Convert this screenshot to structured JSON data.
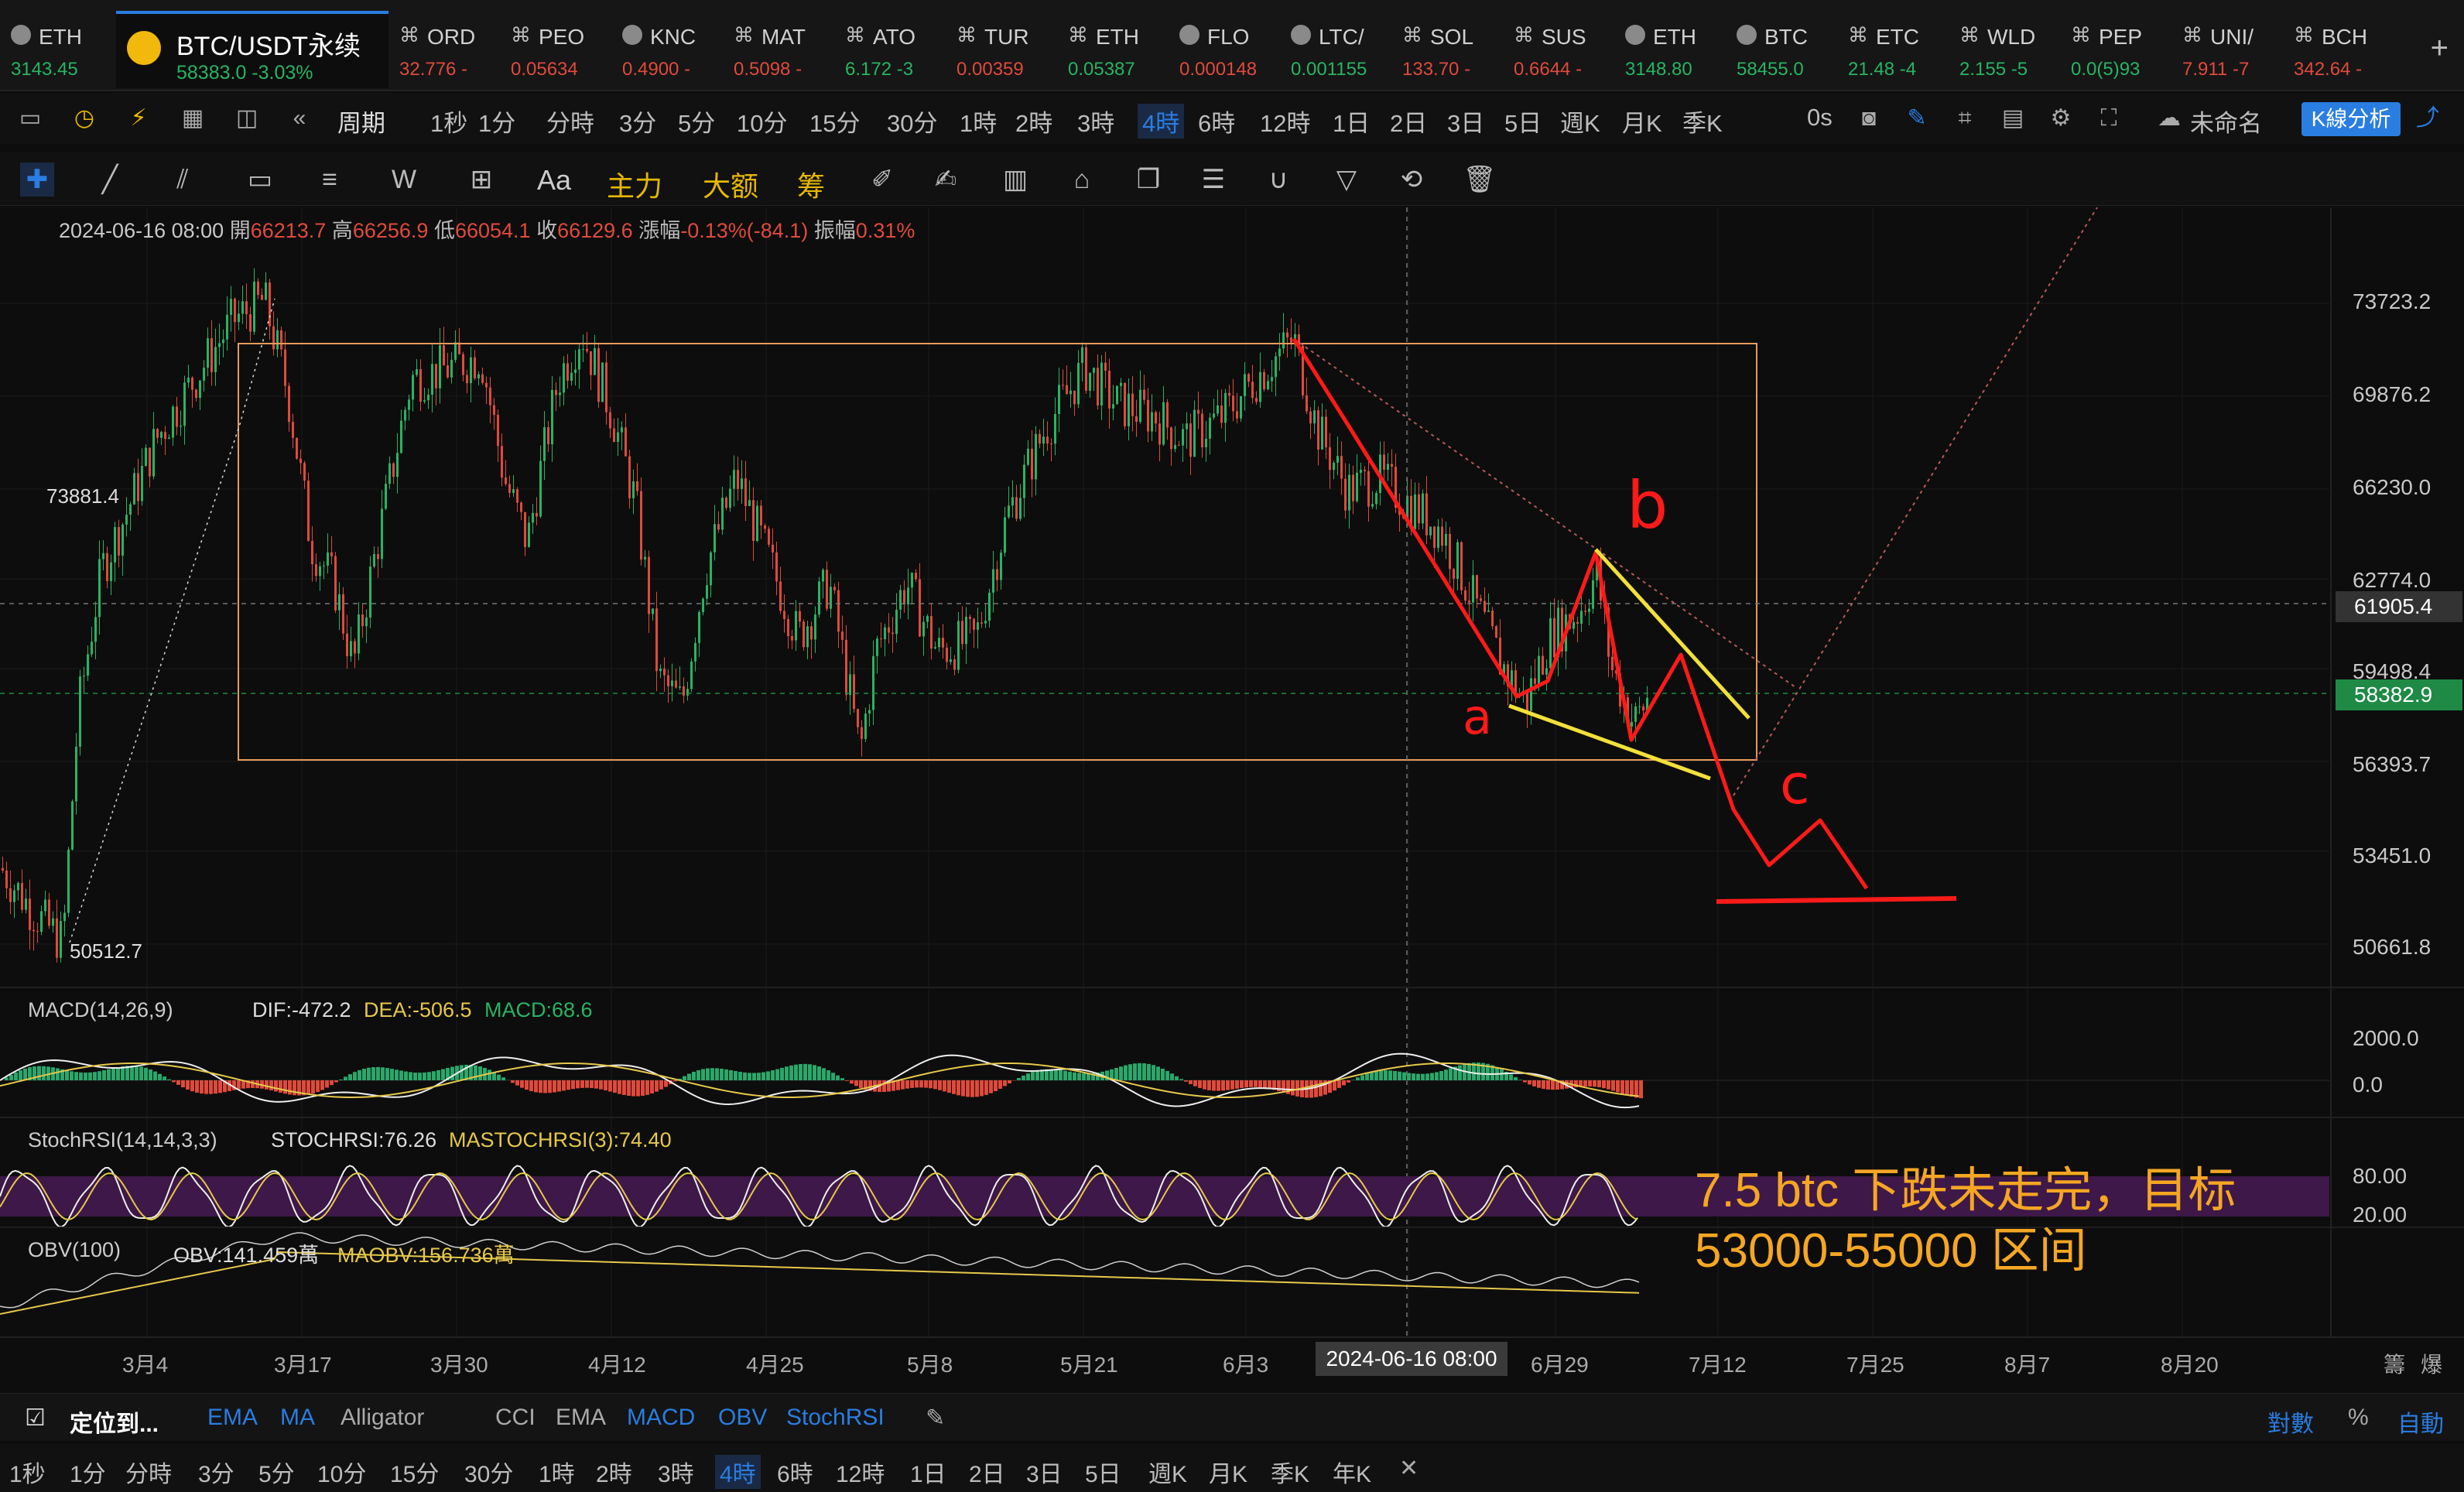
{
  "tabs": [
    {
      "name": "ETH",
      "price": "3143.45",
      "change": "",
      "dir": "up",
      "icon": "coin-icon"
    },
    {
      "name": "ORD",
      "price": "32.776",
      "change": "-",
      "dir": "dn",
      "icon": "pair-icon"
    },
    {
      "name": "PEO",
      "price": "0.05634",
      "change": "",
      "dir": "dn",
      "icon": "pair-icon"
    },
    {
      "name": "KNC",
      "price": "0.4900",
      "change": "-",
      "dir": "dn",
      "icon": "coin-icon"
    },
    {
      "name": "MAT",
      "price": "0.5098",
      "change": "-",
      "dir": "dn",
      "icon": "pair-icon"
    },
    {
      "name": "ATO",
      "price": "6.172",
      "change": "-3",
      "dir": "up",
      "icon": "pair-icon"
    },
    {
      "name": "TUR",
      "price": "0.00359",
      "change": "",
      "dir": "dn",
      "icon": "pair-icon"
    },
    {
      "name": "ETH",
      "price": "0.05387",
      "change": "",
      "dir": "up",
      "icon": "pair-icon"
    },
    {
      "name": "FLO",
      "price": "0.000148",
      "change": "",
      "dir": "dn",
      "icon": "coin-icon"
    },
    {
      "name": "LTC/",
      "price": "0.001155",
      "change": "",
      "dir": "up",
      "icon": "coin-icon"
    },
    {
      "name": "SOL",
      "price": "133.70",
      "change": "-",
      "dir": "dn",
      "icon": "pair-icon"
    },
    {
      "name": "SUS",
      "price": "0.6644",
      "change": "-",
      "dir": "dn",
      "icon": "pair-icon"
    },
    {
      "name": "ETH",
      "price": "3148.80",
      "change": "",
      "dir": "up",
      "icon": "coin-icon"
    },
    {
      "name": "BTC",
      "price": "58455.0",
      "change": "",
      "dir": "up",
      "icon": "coin-icon"
    },
    {
      "name": "ETC",
      "price": "21.48",
      "change": "-4",
      "dir": "up",
      "icon": "pair-icon"
    },
    {
      "name": "WLD",
      "price": "2.155",
      "change": "-5",
      "dir": "up",
      "icon": "pair-icon"
    },
    {
      "name": "PEP",
      "price": "0.0(5)93",
      "change": "",
      "dir": "up",
      "icon": "pair-icon"
    },
    {
      "name": "UNI/",
      "price": "7.911",
      "change": "-7",
      "dir": "dn",
      "icon": "pair-icon"
    },
    {
      "name": "BCH",
      "price": "342.64",
      "change": "-",
      "dir": "dn",
      "icon": "pair-icon"
    }
  ],
  "active_tab": {
    "name": "BTC/USDT永续",
    "info": "58383.0  -3.03%"
  },
  "period_bar": {
    "label": "周期",
    "items": [
      "1秒",
      "1分",
      "分時",
      "3分",
      "5分",
      "10分",
      "15分",
      "30分",
      "1時",
      "2時",
      "3時",
      "4時",
      "6時",
      "12時",
      "1日",
      "2日",
      "3日",
      "5日",
      "週K",
      "月K",
      "季K"
    ],
    "active": "4時",
    "countdown": "0s",
    "layout_name": "未命名",
    "kline_button": "K線分析"
  },
  "draw_bar": {
    "text_tool": "Aa",
    "main_force": "主力",
    "big_order": "大额",
    "chip": "筹"
  },
  "ohlc": {
    "date": "2024-06-16 08:00",
    "open_k": "開",
    "open": "66213.7",
    "high_k": "高",
    "high": "66256.9",
    "low_k": "低",
    "low": "66054.1",
    "close_k": "收",
    "close": "66129.6",
    "chg_k": "漲幅",
    "chg": "-0.13%(-84.1)",
    "amp_k": "振幅",
    "amp": "0.31%"
  },
  "price_scale": [
    "73723.2",
    "69876.2",
    "66230.0",
    "62774.0",
    "59498.4",
    "56393.7",
    "53451.0",
    "50661.8"
  ],
  "price_tags": {
    "crosshair": "61905.4",
    "last": "58382.9"
  },
  "extremes": {
    "high": "73881.4",
    "low": "50512.7"
  },
  "wave_labels": {
    "a": "a",
    "b": "b",
    "c": "c"
  },
  "annotation": [
    "7.5 btc 下跌未走完，目标",
    "53000-55000 区间"
  ],
  "macd": {
    "name": "MACD(14,26,9)",
    "dif": "DIF:-472.2",
    "dea": "DEA:-506.5",
    "macd": "MACD:68.6",
    "scale": [
      "2000.0",
      "0.0"
    ]
  },
  "stochrsi": {
    "name": "StochRSI(14,14,3,3)",
    "k": "STOCHRSI:76.26",
    "d": "MASTOCHRSI(3):74.40",
    "scale": [
      "80.00",
      "20.00"
    ]
  },
  "obv": {
    "name": "OBV(100)",
    "obv": "OBV:141.459萬",
    "ma": "MAOBV:156.736萬"
  },
  "dates": [
    "3月4",
    "3月17",
    "3月30",
    "4月12",
    "4月25",
    "5月8",
    "5月21",
    "6月3",
    "6月29",
    "7月12",
    "7月25",
    "8月7",
    "8月20"
  ],
  "crosshair_date": "2024-06-16 08:00",
  "corner": {
    "chip": "籌",
    "fit": "爆"
  },
  "indicator_bar": {
    "locate": "定位到...",
    "items": [
      {
        "label": "EMA",
        "on": true
      },
      {
        "label": "MA",
        "on": true
      },
      {
        "label": "Alligator",
        "on": false
      },
      {
        "label": "CCI",
        "on": false
      },
      {
        "label": "EMA",
        "on": false
      },
      {
        "label": "MACD",
        "on": true
      },
      {
        "label": "OBV",
        "on": true
      },
      {
        "label": "StochRSI",
        "on": true
      }
    ],
    "log": "對數",
    "pct": "%",
    "auto": "自動"
  },
  "timeframe_bar": {
    "items": [
      "1秒",
      "1分",
      "分時",
      "3分",
      "5分",
      "10分",
      "15分",
      "30分",
      "1時",
      "2時",
      "3時",
      "4時",
      "6時",
      "12時",
      "1日",
      "2日",
      "3日",
      "5日",
      "週K",
      "月K",
      "季K",
      "年K"
    ],
    "active": "4時"
  },
  "colors": {
    "up": "#28b463",
    "down": "#e04a3c",
    "accent": "#2a7de1",
    "box": "#e89a5c",
    "wave": "#ff1a1a",
    "trend": "#f2e03a",
    "annotation": "#f5a623"
  }
}
